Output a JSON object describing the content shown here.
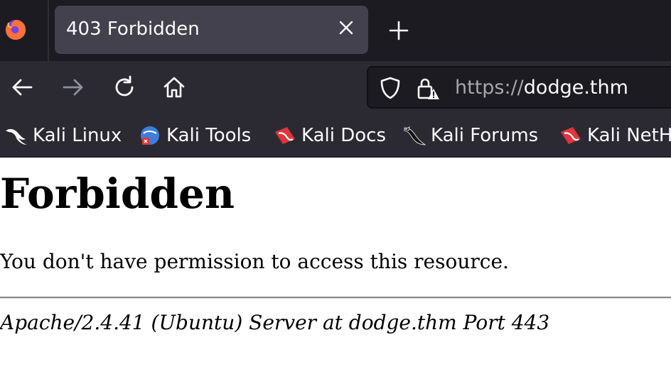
{
  "browser": {
    "tab": {
      "title": "403 Forbidden"
    },
    "address_bar": {
      "scheme": "https://",
      "host": "dodge.thm"
    },
    "bookmarks": [
      {
        "label": "Kali Linux",
        "icon": "kali-dragon-icon"
      },
      {
        "label": "Kali Tools",
        "icon": "kali-tools-icon"
      },
      {
        "label": "Kali Docs",
        "icon": "kali-docs-icon"
      },
      {
        "label": "Kali Forums",
        "icon": "kali-forums-icon"
      },
      {
        "label": "Kali NetH",
        "icon": "kali-nethunter-icon"
      }
    ],
    "colors": {
      "tab_bar": "#1c1b22",
      "toolbar": "#2b2a33",
      "active_tab": "#42414d",
      "text_light": "#fbfbfe"
    }
  },
  "page": {
    "heading": "Forbidden",
    "message": "You don't have permission to access this resource.",
    "server_signature": "Apache/2.4.41 (Ubuntu) Server at dodge.thm Port 443"
  }
}
